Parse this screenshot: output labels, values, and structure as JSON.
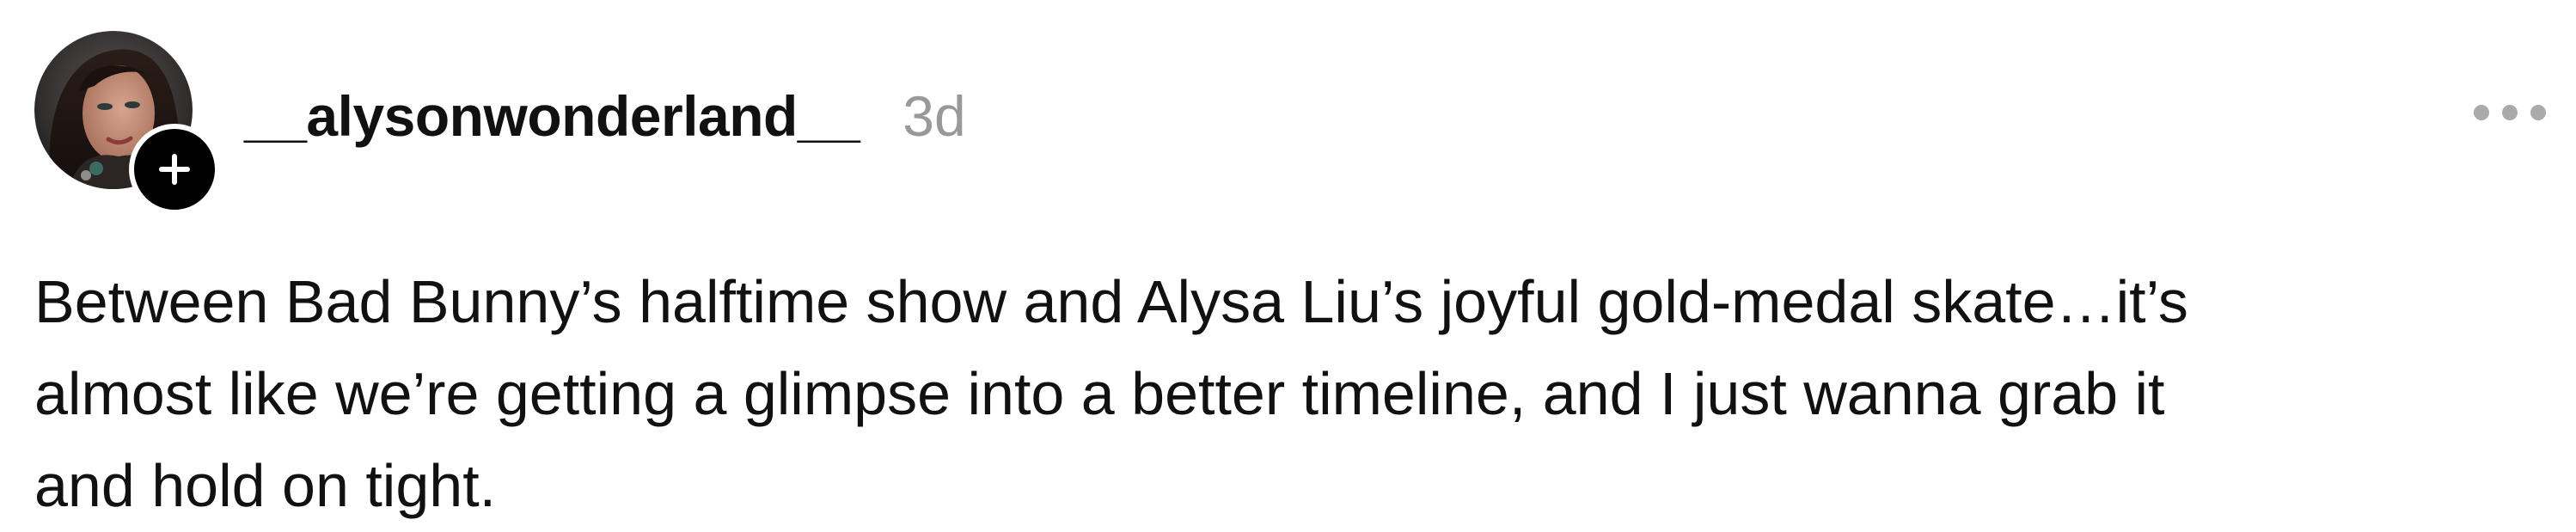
{
  "post": {
    "author": {
      "username": "__alysonwonderland__",
      "avatar_icon": "profile-photo",
      "follow_icon": "plus-icon"
    },
    "timestamp": "3d",
    "more_icon": "more-horizontal-icon",
    "body_lines": [
      "Between Bad Bunny’s halftime show and Alysa Liu’s joyful gold-medal skate…it’s",
      "almost like we’re getting a glimpse into a better timeline, and I just wanna grab it",
      "and hold on tight."
    ]
  },
  "colors": {
    "text": "#111111",
    "muted": "#999999",
    "badge": "#000000",
    "background": "#ffffff"
  }
}
